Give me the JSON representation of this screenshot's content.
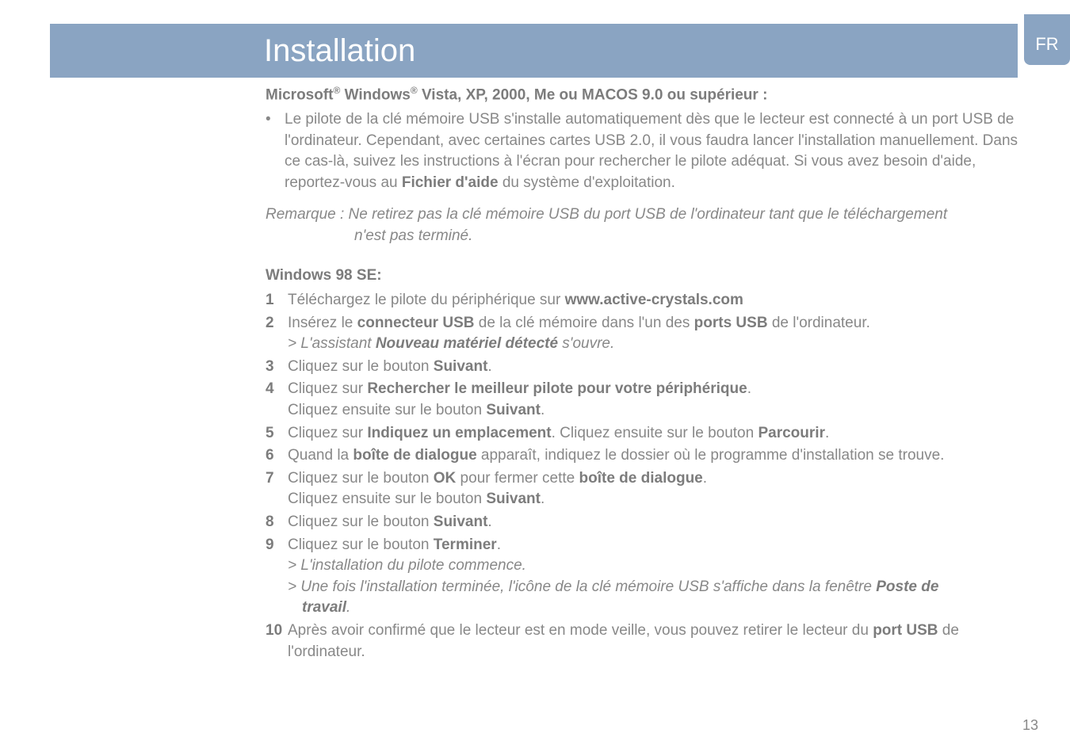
{
  "header": {
    "title": "Installation",
    "lang": "FR"
  },
  "section1": {
    "title_prefix": "Microsoft",
    "title_reg1": "®",
    "title_mid": " Windows",
    "title_reg2": "®",
    "title_suffix": " Vista, XP, 2000, Me ou MACOS 9.0 ou supérieur :",
    "bullet_mark": "•",
    "bullet_text_1": "Le pilote de la clé mémoire USB s'installe automatiquement dès que le lecteur est connecté à un port USB de l'ordinateur. Cependant, avec certaines cartes USB 2.0, il vous faudra lancer l'installation manuellement. Dans ce cas-là, suivez les instructions à l'écran pour rechercher le pilote adéquat. Si vous avez besoin d'aide, reportez-vous au ",
    "bullet_bold": "Fichier d'aide",
    "bullet_text_2": " du système d'exploitation."
  },
  "remarque": {
    "line1": "Remarque : Ne retirez pas la clé mémoire USB du port USB de l'ordinateur tant que le téléchargement",
    "line2": "n'est pas terminé."
  },
  "section2": {
    "title": "Windows 98 SE:"
  },
  "steps": {
    "s1_num": "1",
    "s1_a": "Téléchargez le pilote du périphérique sur ",
    "s1_b": "www.active-crystals.com",
    "s2_num": "2",
    "s2_a": "Insérez le ",
    "s2_b": "connecteur USB",
    "s2_c": " de la clé mémoire dans l'un des ",
    "s2_d": "ports USB",
    "s2_e": " de l'ordinateur.",
    "s2_f": "> L'assistant ",
    "s2_g": "Nouveau matériel détecté",
    "s2_h": " s'ouvre.",
    "s3_num": "3",
    "s3_a": "Cliquez sur le bouton ",
    "s3_b": "Suivant",
    "s3_c": ".",
    "s4_num": "4",
    "s4_a": "Cliquez sur ",
    "s4_b": "Rechercher le meilleur pilote pour votre périphérique",
    "s4_c": ".",
    "s4_d": "Cliquez ensuite sur le bouton ",
    "s4_e": "Suivant",
    "s4_f": ".",
    "s5_num": "5",
    "s5_a": "Cliquez sur ",
    "s5_b": "Indiquez un emplacement",
    "s5_c": ". Cliquez ensuite sur le bouton ",
    "s5_d": "Parcourir",
    "s5_e": ".",
    "s6_num": "6",
    "s6_a": "Quand la ",
    "s6_b": "boîte de dialogue",
    "s6_c": " apparaît, indiquez le dossier où le programme d'installation se trouve.",
    "s7_num": "7",
    "s7_a": "Cliquez sur le bouton ",
    "s7_b": "OK",
    "s7_c": " pour fermer cette ",
    "s7_d": "boîte de dialogue",
    "s7_e": ".",
    "s7_f": "Cliquez ensuite sur le bouton ",
    "s7_g": "Suivant",
    "s7_h": ".",
    "s8_num": "8",
    "s8_a": "Cliquez sur le bouton ",
    "s8_b": "Suivant",
    "s8_c": ".",
    "s9_num": "9",
    "s9_a": "Cliquez sur le bouton ",
    "s9_b": "Terminer",
    "s9_c": ".",
    "s9_d": "> L'installation du pilote commence.",
    "s9_e": "> Une fois l'installation terminée, l'icône de la clé mémoire USB s'affiche dans la fenêtre ",
    "s9_f": "Poste de",
    "s9_g": "travail",
    "s9_h": ".",
    "s10_num": "10",
    "s10_a": "Après avoir confirmé que le lecteur est en mode veille, vous pouvez retirer le lecteur du ",
    "s10_b": "port USB",
    "s10_c": " de l'ordinateur."
  },
  "page_number": "13"
}
